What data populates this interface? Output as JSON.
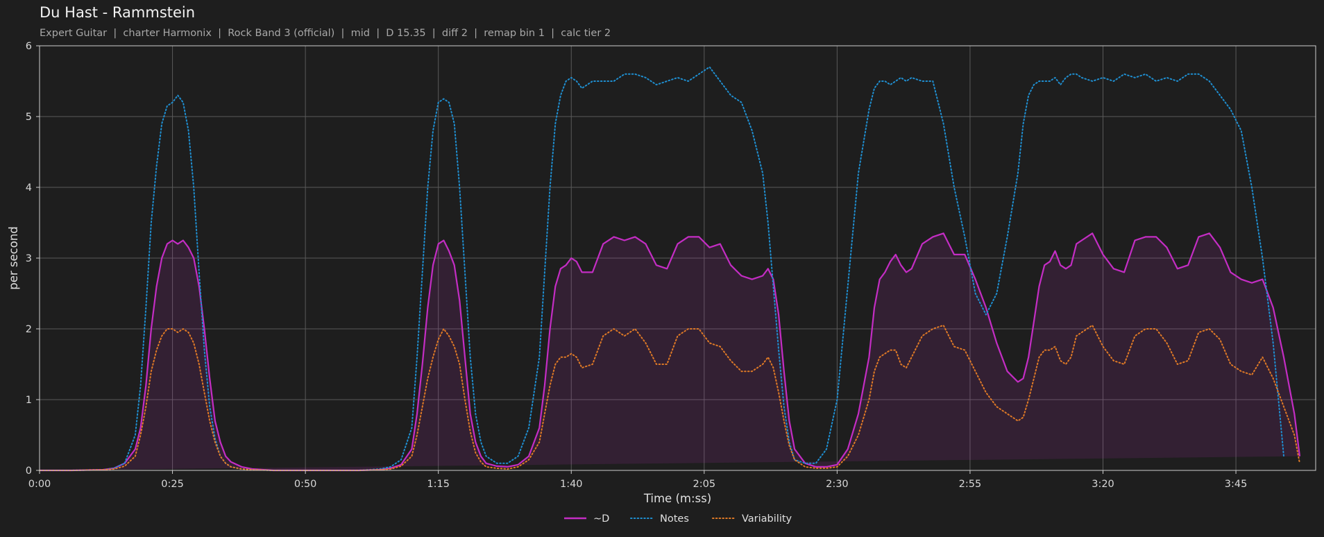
{
  "chart_data": {
    "type": "line",
    "title": "Du Hast - Rammstein",
    "subtitle": "Expert Guitar  |  charter Harmonix  |  Rock Band 3 (official)  |  mid  |  D 15.35  |  diff 2  |  remap bin 1  |  calc tier 2",
    "xlabel": "Time (m:ss)",
    "ylabel": "per second",
    "xlim": [
      0,
      240
    ],
    "ylim": [
      0,
      6
    ],
    "grid": true,
    "legend_position": "bottom-center",
    "x_ticks": [
      0,
      25,
      50,
      75,
      100,
      125,
      150,
      175,
      200,
      225
    ],
    "x_tick_labels": [
      "0:00",
      "0:25",
      "0:50",
      "1:15",
      "1:40",
      "2:05",
      "2:30",
      "2:55",
      "3:20",
      "3:45"
    ],
    "y_ticks": [
      0,
      1,
      2,
      3,
      4,
      5,
      6
    ],
    "y_tick_labels": [
      "0",
      "1",
      "2",
      "3",
      "4",
      "5",
      "6"
    ],
    "x": [
      0,
      6,
      12,
      14,
      16,
      18,
      19,
      20,
      21,
      22,
      23,
      24,
      25,
      26,
      27,
      28,
      29,
      30,
      31,
      32,
      33,
      34,
      35,
      36,
      38,
      40,
      44,
      48,
      52,
      56,
      60,
      64,
      66,
      68,
      70,
      71,
      72,
      73,
      74,
      75,
      76,
      77,
      78,
      79,
      80,
      81,
      82,
      83,
      84,
      86,
      88,
      90,
      92,
      94,
      95,
      96,
      97,
      98,
      99,
      100,
      101,
      102,
      104,
      106,
      108,
      110,
      112,
      114,
      116,
      118,
      120,
      122,
      124,
      126,
      128,
      130,
      132,
      134,
      136,
      137,
      138,
      139,
      140,
      141,
      142,
      144,
      146,
      148,
      150,
      152,
      154,
      156,
      157,
      158,
      159,
      160,
      161,
      162,
      163,
      164,
      166,
      168,
      170,
      172,
      174,
      176,
      178,
      180,
      182,
      184,
      185,
      186,
      187,
      188,
      189,
      190,
      191,
      192,
      193,
      194,
      195,
      196,
      198,
      200,
      202,
      204,
      206,
      208,
      210,
      212,
      214,
      216,
      218,
      220,
      222,
      224,
      226,
      228,
      230,
      232,
      234,
      236,
      237,
      238,
      239,
      240
    ],
    "series": [
      {
        "name": "~D",
        "style": "solid",
        "color": "#c42dc4",
        "fill": true,
        "values": [
          0,
          0,
          0.01,
          0.03,
          0.1,
          0.3,
          0.6,
          1.2,
          2.0,
          2.6,
          3.0,
          3.2,
          3.25,
          3.2,
          3.25,
          3.15,
          3.0,
          2.6,
          2.0,
          1.3,
          0.7,
          0.4,
          0.2,
          0.12,
          0.05,
          0.02,
          0,
          0,
          0,
          0,
          0,
          0.01,
          0.03,
          0.08,
          0.3,
          0.8,
          1.5,
          2.3,
          2.9,
          3.2,
          3.25,
          3.1,
          2.9,
          2.4,
          1.6,
          0.8,
          0.4,
          0.2,
          0.1,
          0.06,
          0.05,
          0.08,
          0.2,
          0.6,
          1.2,
          2.0,
          2.6,
          2.85,
          2.9,
          3.0,
          2.95,
          2.8,
          2.8,
          3.2,
          3.3,
          3.25,
          3.3,
          3.2,
          2.9,
          2.85,
          3.2,
          3.3,
          3.3,
          3.15,
          3.2,
          2.9,
          2.75,
          2.7,
          2.75,
          2.85,
          2.7,
          2.2,
          1.4,
          0.7,
          0.3,
          0.1,
          0.05,
          0.05,
          0.08,
          0.3,
          0.8,
          1.6,
          2.3,
          2.7,
          2.8,
          2.95,
          3.05,
          2.9,
          2.8,
          2.85,
          3.2,
          3.3,
          3.35,
          3.05,
          3.05,
          2.7,
          2.3,
          1.8,
          1.4,
          1.25,
          1.3,
          1.6,
          2.1,
          2.6,
          2.9,
          2.95,
          3.1,
          2.9,
          2.85,
          2.9,
          3.2,
          3.25,
          3.35,
          3.05,
          2.85,
          2.8,
          3.25,
          3.3,
          3.3,
          3.15,
          2.85,
          2.9,
          3.3,
          3.35,
          3.15,
          2.8,
          2.7,
          2.65,
          2.7,
          2.3,
          1.6,
          0.8,
          0.2
        ]
      },
      {
        "name": "Notes",
        "style": "dotted",
        "color": "#1f8fd1",
        "values": [
          0,
          0,
          0.01,
          0.03,
          0.1,
          0.5,
          1.2,
          2.3,
          3.5,
          4.3,
          4.9,
          5.15,
          5.2,
          5.3,
          5.2,
          4.8,
          4.0,
          2.8,
          1.7,
          0.9,
          0.45,
          0.2,
          0.1,
          0.05,
          0.02,
          0.01,
          0,
          0,
          0,
          0,
          0,
          0.02,
          0.05,
          0.15,
          0.6,
          1.6,
          2.8,
          4.0,
          4.8,
          5.2,
          5.25,
          5.2,
          4.9,
          4.0,
          2.8,
          1.6,
          0.8,
          0.4,
          0.2,
          0.1,
          0.1,
          0.2,
          0.6,
          1.6,
          2.8,
          4.0,
          4.9,
          5.3,
          5.5,
          5.55,
          5.5,
          5.4,
          5.5,
          5.5,
          5.5,
          5.6,
          5.6,
          5.55,
          5.45,
          5.5,
          5.55,
          5.5,
          5.6,
          5.7,
          5.5,
          5.3,
          5.2,
          4.8,
          4.2,
          3.5,
          2.6,
          1.7,
          0.9,
          0.4,
          0.15,
          0.1,
          0.1,
          0.3,
          1.0,
          2.6,
          4.2,
          5.1,
          5.4,
          5.5,
          5.5,
          5.45,
          5.5,
          5.55,
          5.5,
          5.55,
          5.5,
          5.5,
          4.9,
          4.0,
          3.3,
          2.5,
          2.2,
          2.5,
          3.3,
          4.2,
          4.9,
          5.3,
          5.45,
          5.5,
          5.5,
          5.5,
          5.55,
          5.45,
          5.55,
          5.6,
          5.6,
          5.55,
          5.5,
          5.55,
          5.5,
          5.6,
          5.55,
          5.6,
          5.5,
          5.55,
          5.5,
          5.6,
          5.6,
          5.5,
          5.3,
          5.1,
          4.8,
          4.0,
          3.0,
          1.8,
          0.2
        ]
      },
      {
        "name": "Variability",
        "style": "dotted",
        "color": "#e07a26",
        "values": [
          0,
          0,
          0.01,
          0.02,
          0.06,
          0.2,
          0.5,
          0.9,
          1.4,
          1.7,
          1.9,
          2.0,
          2.0,
          1.95,
          2.0,
          1.95,
          1.8,
          1.5,
          1.1,
          0.7,
          0.4,
          0.2,
          0.1,
          0.05,
          0.02,
          0.01,
          0,
          0,
          0,
          0,
          0,
          0.01,
          0.02,
          0.06,
          0.2,
          0.5,
          0.9,
          1.3,
          1.6,
          1.85,
          2.0,
          1.9,
          1.75,
          1.5,
          1.0,
          0.55,
          0.25,
          0.12,
          0.05,
          0.03,
          0.02,
          0.05,
          0.15,
          0.4,
          0.8,
          1.2,
          1.5,
          1.6,
          1.6,
          1.65,
          1.6,
          1.45,
          1.5,
          1.9,
          2.0,
          1.9,
          2.0,
          1.8,
          1.5,
          1.5,
          1.9,
          2.0,
          2.0,
          1.8,
          1.75,
          1.55,
          1.4,
          1.4,
          1.5,
          1.6,
          1.45,
          1.1,
          0.7,
          0.35,
          0.15,
          0.05,
          0.03,
          0.03,
          0.05,
          0.2,
          0.5,
          1.0,
          1.4,
          1.6,
          1.65,
          1.7,
          1.7,
          1.5,
          1.45,
          1.6,
          1.9,
          2.0,
          2.05,
          1.75,
          1.7,
          1.4,
          1.1,
          0.9,
          0.8,
          0.7,
          0.75,
          1.0,
          1.3,
          1.6,
          1.7,
          1.7,
          1.75,
          1.55,
          1.5,
          1.6,
          1.9,
          1.95,
          2.05,
          1.75,
          1.55,
          1.5,
          1.9,
          2.0,
          2.0,
          1.8,
          1.5,
          1.55,
          1.95,
          2.0,
          1.85,
          1.5,
          1.4,
          1.35,
          1.6,
          1.3,
          0.9,
          0.5,
          0.1
        ]
      }
    ]
  }
}
